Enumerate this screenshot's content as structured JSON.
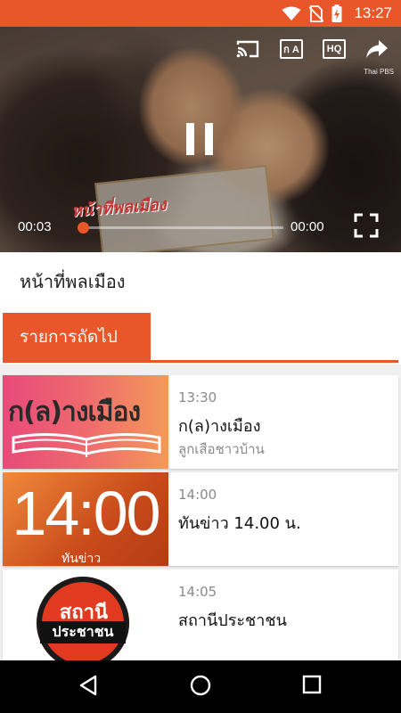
{
  "status_bar": {
    "time": "13:27",
    "icons": [
      "wifi-icon",
      "no-sim-icon",
      "battery-charging-icon"
    ]
  },
  "player": {
    "current_time": "00:03",
    "duration": "00:00",
    "progress_fraction": 0.03,
    "controls": [
      "cast-icon",
      "subtitles-icon",
      "hq-quality-icon",
      "share-icon",
      "pause-icon",
      "fullscreen-icon"
    ],
    "cc_label": "ก A",
    "hq_label": "HQ",
    "channel_watermark": "Thai PBS",
    "show_watermark": "หน้าที่พลเมือง"
  },
  "program": {
    "title": "หน้าที่พลเมือง"
  },
  "section": {
    "label": "รายการถัดไป"
  },
  "schedule": [
    {
      "time": "13:30",
      "name": "ก(ล)างเมือง",
      "subtitle": "ลูกเสือชาวบ้าน",
      "thumb_text": "ก(ล)างเมือง"
    },
    {
      "time": "14:00",
      "name": "ทันข่าว 14.00 น.",
      "subtitle": "",
      "thumb_text": "14:00",
      "thumb_caption": "ทันข่าว"
    },
    {
      "time": "14:05",
      "name": "สถานีประชาชน",
      "subtitle": "",
      "thumb_text": "สถานี",
      "thumb_caption": "ประชาชน"
    }
  ],
  "colors": {
    "accent": "#e8562a",
    "navbar": "#000000"
  },
  "nav": [
    "back-icon",
    "home-icon",
    "recents-icon"
  ]
}
